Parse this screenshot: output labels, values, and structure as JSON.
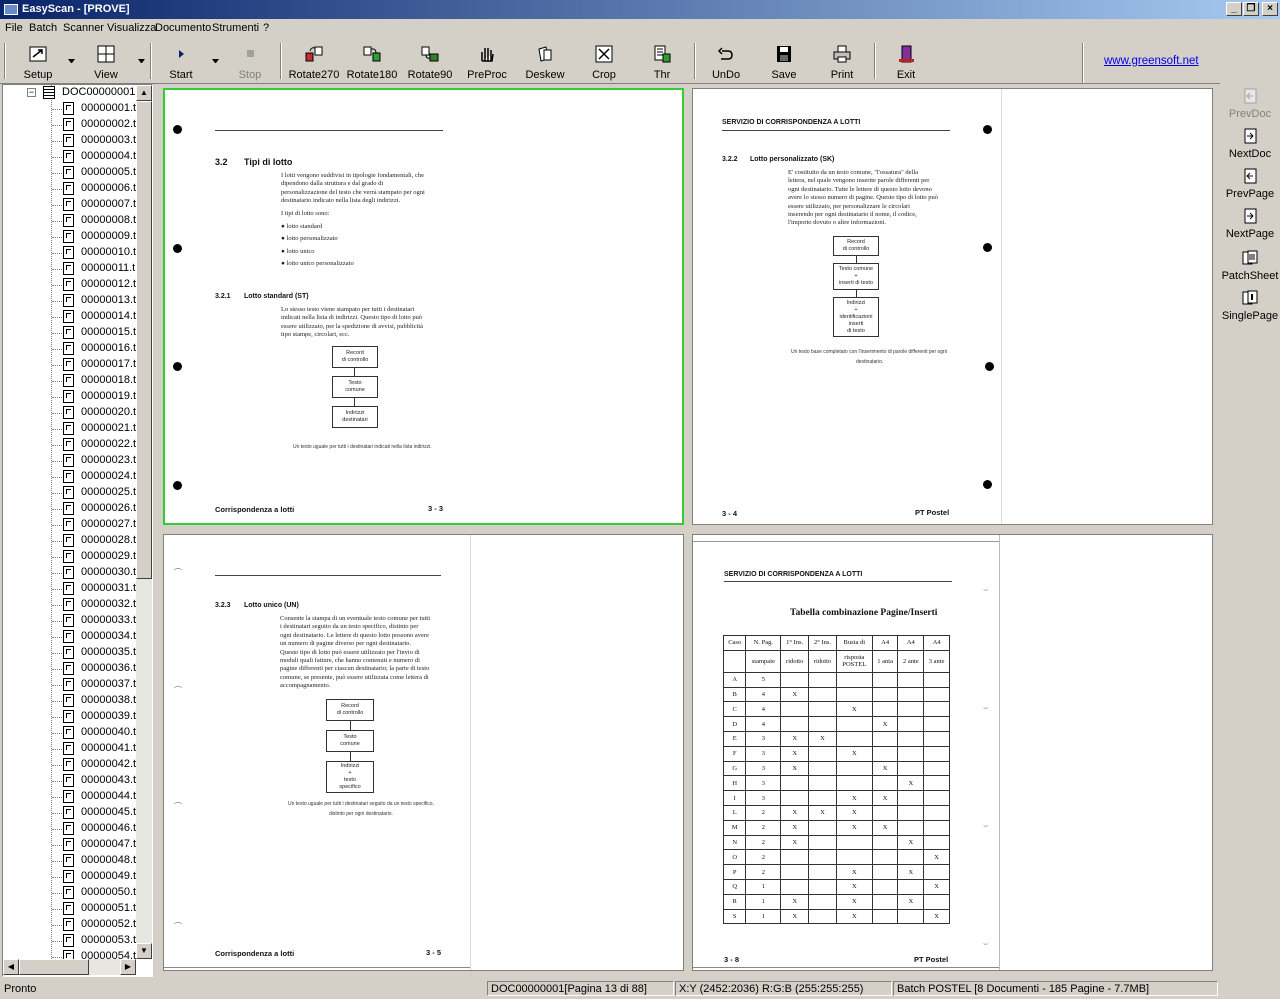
{
  "window": {
    "title": "EasyScan - [PROVE]"
  },
  "menu": [
    "File",
    "Batch",
    "Scanner",
    "Visualizza",
    "Documento",
    "Strumenti",
    "?"
  ],
  "toolbar": {
    "setup": "Setup",
    "view": "View",
    "start": "Start",
    "stop": "Stop",
    "rotate270": "Rotate270",
    "rotate180": "Rotate180",
    "rotate90": "Rotate90",
    "preproc": "PreProc",
    "deskew": "Deskew",
    "crop": "Crop",
    "thr": "Thr",
    "undo": "UnDo",
    "save": "Save",
    "print": "Print",
    "exit": "Exit"
  },
  "website": "www.greensoft.net",
  "tree": {
    "root": "DOC00000001",
    "pages": [
      "00000001.t",
      "00000002.t",
      "00000003.t",
      "00000004.t",
      "00000005.t",
      "00000006.t",
      "00000007.t",
      "00000008.t",
      "00000009.t",
      "00000010.t",
      "00000011.t",
      "00000012.t",
      "00000013.t",
      "00000014.t",
      "00000015.t",
      "00000016.t",
      "00000017.t",
      "00000018.t",
      "00000019.t",
      "00000020.t",
      "00000021.t",
      "00000022.t",
      "00000023.t",
      "00000024.t",
      "00000025.t",
      "00000026.t",
      "00000027.t",
      "00000028.t",
      "00000029.t",
      "00000030.t",
      "00000031.t",
      "00000032.t",
      "00000033.t",
      "00000034.t",
      "00000035.t",
      "00000036.t",
      "00000037.t",
      "00000038.t",
      "00000039.t",
      "00000040.t",
      "00000041.t",
      "00000042.t",
      "00000043.t",
      "00000044.t",
      "00000045.t",
      "00000046.t",
      "00000047.t",
      "00000048.t",
      "00000049.t",
      "00000050.t",
      "00000051.t",
      "00000052.t",
      "00000053.t",
      "00000054.t"
    ]
  },
  "side": {
    "prevdoc": "PrevDoc",
    "nextdoc": "NextDoc",
    "prevpage": "PrevPage",
    "nextpage": "NextPage",
    "patchsheet": "PatchSheet",
    "singlepage": "SinglePage"
  },
  "pages": {
    "p1": {
      "heading_num": "3.2",
      "heading": "Tipi di lotto",
      "intro": "I lotti vengono suddivisi in tipologie fondamentali, che\ndipendono dalla struttura e dal grado di\npersonalizzazione del testo che verrà stampato per ogni\ndestinatario indicato nella lista degli indirizzi.",
      "types_intro": "I tipi di lotto sono:",
      "types": [
        "lotto standard",
        "lotto personalizzato",
        "lotto unico",
        "lotto unico personalizzato"
      ],
      "sub_num": "3.2.1",
      "sub": "Lotto standard (ST)",
      "body": "Lo stesso testo viene stampato per tutti i destinatari\nindicati nella lista di indirizzi. Questo tipo di lotto può\nessere utilizzato, per la spedizione di avvisi, pubblicità\ntipo stampe, circolari, ecc.",
      "boxes": [
        "Record\ndi controllo",
        "Testo\ncomune",
        "Indirizzi\ndestinatari"
      ],
      "caption": "Un testo uguale per tutti i destinatari indicati nella lista indirizzi.",
      "foot_left": "Corrispondenza a lotti",
      "foot_right": "3 - 3"
    },
    "p2": {
      "header": "SERVIZIO DI CORRISPONDENZA A LOTTI",
      "sub_num": "3.2.2",
      "sub": "Lotto personalizzato (SK)",
      "body": "E' costituito da un testo comune, \"l'ossatura\" della\nlettera, nel quale vengono inserite parole differenti per\nogni destinatario. Tutte le lettere di questo lotto devono\navere lo stesso numero di pagine. Questo tipo di lotto può\nessere utilizzato, per personalizzare le circolari\ninserendo per ogni destinatario il nome, il codice,\nl'importo dovuto o altre informazioni.",
      "boxes": [
        "Record\ndi controllo",
        "Testo comune\n+\ninserti di testo",
        "Indirizzi\n+\nidentificazioni\ninserti\ndi testo"
      ],
      "caption1": "Un testo base completato con l'inserimento di parole differenti per ogni",
      "caption2": "destinatario.",
      "foot_left": "3 - 4",
      "foot_right": "PT Postel"
    },
    "p3": {
      "sub_num": "3.2.3",
      "sub": "Lotto unico (UN)",
      "body": "Consente la stampa di un eventuale testo comune per tutti\ni destinatari seguito da un testo specifico, distinto per\nogni destinatario. Le lettere di questo lotto possono avere\nun numero di pagine diverso per ogni destinatario.\nQuesto tipo di lotto può essere utilizzato per l'invio di\nmoduli quali fatture, che hanno contenuti e numero di\npagine differenti per ciascun destinatario; la parte di testo\ncomune, se presente, può essere utilizzata come lettera di\naccompagnamento.",
      "boxes": [
        "Record\ndi controllo",
        "Testo\ncomune",
        "Indirizzi\n+\ntesto\nspecifico"
      ],
      "caption1": "Un testo uguale per tutti i destinatari seguito da un testo specifico,",
      "caption2": "distinto per ogni destinatario.",
      "foot_left": "Corrispondenza a lotti",
      "foot_right": "3 - 5"
    },
    "p4": {
      "header": "SERVIZIO DI CORRISPONDENZA A LOTTI",
      "table_title": "Tabella combinazione Pagine/Inserti",
      "table_head1": [
        "Caso",
        "N. Pag.",
        "1° Ins.",
        "2° Ins.",
        "Busta di",
        "A4",
        "A4",
        "A4"
      ],
      "table_head2": [
        "",
        "stampate",
        "ridotto",
        "ridotto",
        "risposta\nPOSTEL",
        "1 anta",
        "2 ante",
        "3 ante"
      ],
      "rows": [
        [
          "A",
          "5",
          "",
          "",
          "",
          "",
          "",
          ""
        ],
        [
          "B",
          "4",
          "X",
          "",
          "",
          "",
          "",
          ""
        ],
        [
          "C",
          "4",
          "",
          "",
          "X",
          "",
          "",
          ""
        ],
        [
          "D",
          "4",
          "",
          "",
          "",
          "X",
          "",
          ""
        ],
        [
          "E",
          "3",
          "X",
          "X",
          "",
          "",
          "",
          ""
        ],
        [
          "F",
          "3",
          "X",
          "",
          "X",
          "",
          "",
          ""
        ],
        [
          "G",
          "3",
          "X",
          "",
          "",
          "X",
          "",
          ""
        ],
        [
          "H",
          "3",
          "",
          "",
          "",
          "",
          "X",
          ""
        ],
        [
          "I",
          "3",
          "",
          "",
          "X",
          "X",
          "",
          ""
        ],
        [
          "L",
          "2",
          "X",
          "X",
          "X",
          "",
          "",
          ""
        ],
        [
          "M",
          "2",
          "X",
          "",
          "X",
          "X",
          "",
          ""
        ],
        [
          "N",
          "2",
          "X",
          "",
          "",
          "",
          "X",
          ""
        ],
        [
          "O",
          "2",
          "",
          "",
          "",
          "",
          "",
          "X"
        ],
        [
          "P",
          "2",
          "",
          "",
          "X",
          "",
          "X",
          ""
        ],
        [
          "Q",
          "1",
          "",
          "",
          "X",
          "",
          "",
          "X"
        ],
        [
          "R",
          "1",
          "X",
          "",
          "X",
          "",
          "X",
          ""
        ],
        [
          "S",
          "1",
          "X",
          "",
          "X",
          "",
          "",
          "X"
        ]
      ],
      "foot_left": "3 - 8",
      "foot_right": "PT Postel"
    }
  },
  "status": {
    "ready": "Pronto",
    "doc": "DOC00000001[Pagina 13 di 88]",
    "coords": "X:Y (2452:2036) R:G:B (255:255:255)",
    "batch": "Batch POSTEL [8 Documenti - 185 Pagine - 7.7MB]"
  }
}
